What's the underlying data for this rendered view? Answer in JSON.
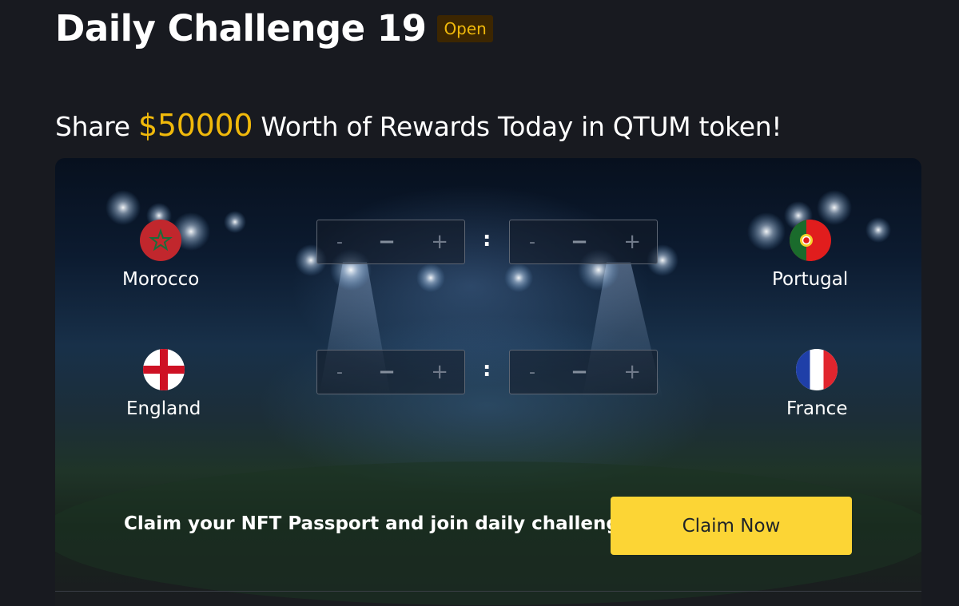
{
  "header": {
    "title": "Daily Challenge 19",
    "status_badge": "Open"
  },
  "promo": {
    "prefix": "Share",
    "amount": "$50000",
    "suffix": "Worth of Rewards Today in QTUM token!"
  },
  "matches": [
    {
      "home": {
        "name": "Morocco",
        "flag": "morocco-flag-icon"
      },
      "away": {
        "name": "Portugal",
        "flag": "portugal-flag-icon"
      },
      "home_score": {
        "dec": "-",
        "value": "−",
        "inc": "+"
      },
      "away_score": {
        "dec": "-",
        "value": "−",
        "inc": "+"
      },
      "separator": ":"
    },
    {
      "home": {
        "name": "England",
        "flag": "england-flag-icon"
      },
      "away": {
        "name": "France",
        "flag": "france-flag-icon"
      },
      "home_score": {
        "dec": "-",
        "value": "−",
        "inc": "+"
      },
      "away_score": {
        "dec": "-",
        "value": "−",
        "inc": "+"
      },
      "separator": ":"
    }
  ],
  "cta": {
    "text": "Claim your NFT Passport and join daily challenges",
    "button_label": "Claim Now"
  },
  "colors": {
    "background": "#181a20",
    "accent": "#f0b90b",
    "button": "#fcd535"
  }
}
